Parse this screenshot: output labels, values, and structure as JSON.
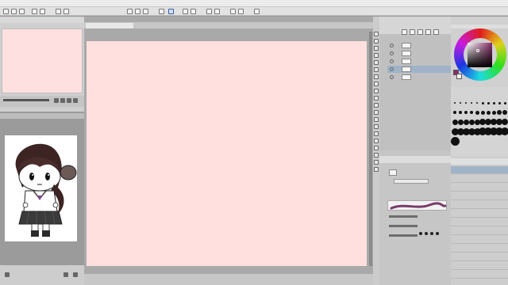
{
  "app": {
    "title": "",
    "menu": []
  },
  "canvas": {
    "background": "#ffe0de"
  },
  "layers": {
    "items": [
      {
        "label": ""
      },
      {
        "label": ""
      },
      {
        "label": ""
      },
      {
        "label": ""
      },
      {
        "label": ""
      }
    ]
  },
  "subtools": {
    "items": [
      {
        "label": ""
      },
      {
        "label": ""
      },
      {
        "label": ""
      },
      {
        "label": ""
      },
      {
        "label": ""
      },
      {
        "label": ""
      },
      {
        "label": ""
      },
      {
        "label": ""
      },
      {
        "label": ""
      },
      {
        "label": ""
      },
      {
        "label": ""
      },
      {
        "label": ""
      },
      {
        "label": ""
      }
    ]
  },
  "colors": {
    "accent": "#8a2d6a",
    "canvas": "#ffe0de"
  },
  "icons": {
    "toolbar": [
      "new-icon",
      "open-icon",
      "save-icon",
      "undo-icon",
      "redo-icon",
      "copy-icon",
      "paste-icon",
      "zoom-icon",
      "rotate-icon",
      "flip-icon",
      "grid-icon",
      "ruler-icon"
    ],
    "tools": [
      "zoom-tool-icon",
      "move-tool-icon",
      "select-tool-icon",
      "lasso-tool-icon",
      "eyedropper-tool-icon",
      "pen-tool-icon",
      "pencil-tool-icon",
      "brush-tool-icon",
      "airbrush-tool-icon",
      "decoration-tool-icon",
      "eraser-tool-icon",
      "blend-tool-icon",
      "fill-tool-icon",
      "gradient-tool-icon",
      "figure-tool-icon",
      "frame-tool-icon",
      "ruler-tool-icon",
      "text-tool-icon",
      "balloon-tool-icon",
      "correction-tool-icon"
    ]
  }
}
